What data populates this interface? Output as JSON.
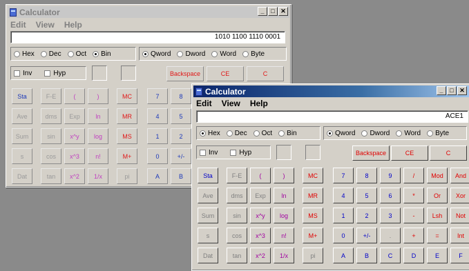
{
  "back_window": {
    "title": "Calculator",
    "menu": [
      "Edit",
      "View",
      "Help"
    ],
    "display": "1010 1100 1110 0001",
    "bases": [
      "Hex",
      "Dec",
      "Oct",
      "Bin"
    ],
    "selected_base": "Bin",
    "word_sizes": [
      "Qword",
      "Dword",
      "Word",
      "Byte"
    ],
    "selected_word_size": "Qword",
    "inv_label": "Inv",
    "hyp_label": "Hyp",
    "backspace": "Backspace",
    "ce": "CE",
    "c": "C",
    "rows": [
      [
        "Sta",
        "F-E",
        "(",
        ")",
        "MC",
        "7",
        "8"
      ],
      [
        "Ave",
        "dms",
        "Exp",
        "ln",
        "MR",
        "4",
        "5"
      ],
      [
        "Sum",
        "sin",
        "x^y",
        "log",
        "MS",
        "1",
        "2"
      ],
      [
        "s",
        "cos",
        "x^3",
        "n!",
        "M+",
        "0",
        "+/-"
      ],
      [
        "Dat",
        "tan",
        "x^2",
        "1/x",
        "pi",
        "A",
        "B"
      ]
    ]
  },
  "front_window": {
    "title": "Calculator",
    "menu": [
      "Edit",
      "View",
      "Help"
    ],
    "display": "ACE1",
    "bases": [
      "Hex",
      "Dec",
      "Oct",
      "Bin"
    ],
    "selected_base": "Hex",
    "word_sizes": [
      "Qword",
      "Dword",
      "Word",
      "Byte"
    ],
    "selected_word_size": "Qword",
    "inv_label": "Inv",
    "hyp_label": "Hyp",
    "backspace": "Backspace",
    "ce": "CE",
    "c": "C",
    "rows": [
      [
        "Sta",
        "F-E",
        "(",
        ")",
        "MC",
        "7",
        "8",
        "9",
        "/",
        "Mod",
        "And"
      ],
      [
        "Ave",
        "dms",
        "Exp",
        "ln",
        "MR",
        "4",
        "5",
        "6",
        "*",
        "Or",
        "Xor"
      ],
      [
        "Sum",
        "sin",
        "x^y",
        "log",
        "MS",
        "1",
        "2",
        "3",
        "-",
        "Lsh",
        "Not"
      ],
      [
        "s",
        "cos",
        "x^3",
        "n!",
        "M+",
        "0",
        "+/-",
        ".",
        "+",
        "=",
        "Int"
      ],
      [
        "Dat",
        "tan",
        "x^2",
        "1/x",
        "pi",
        "A",
        "B",
        "C",
        "D",
        "E",
        "F"
      ]
    ]
  }
}
